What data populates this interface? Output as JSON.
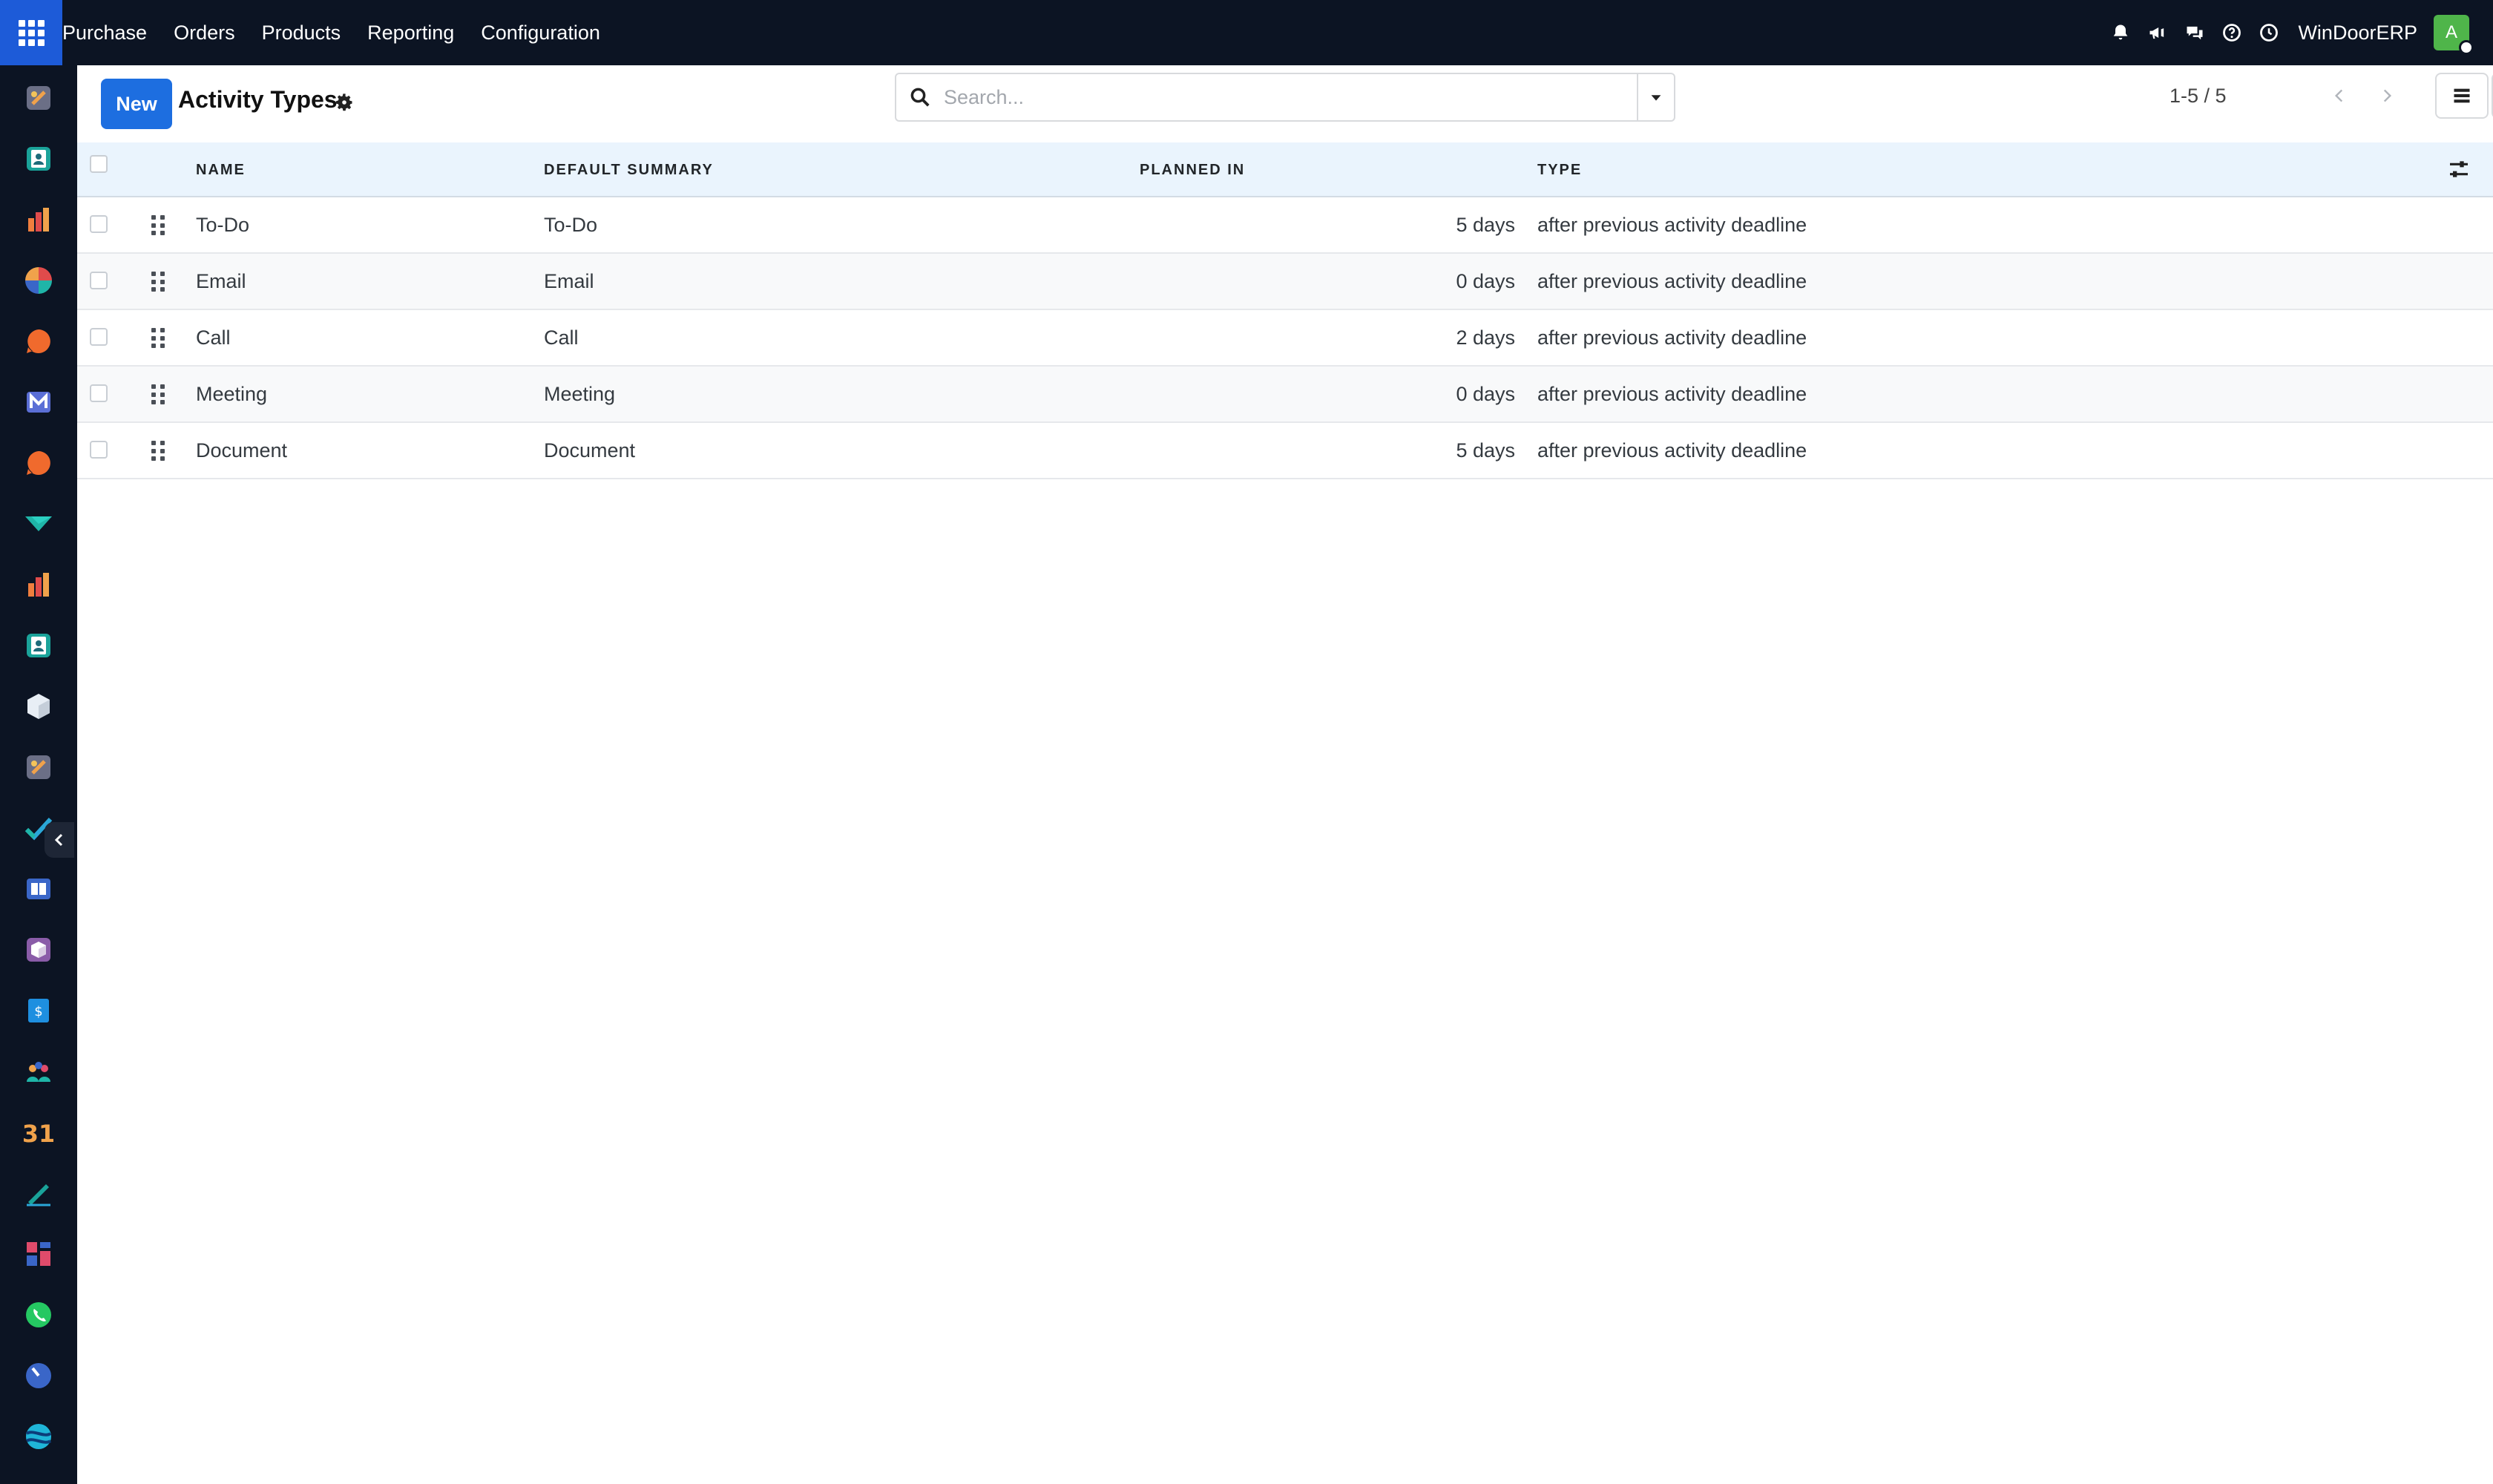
{
  "topbar": {
    "menu": [
      "Purchase",
      "Orders",
      "Products",
      "Reporting",
      "Configuration"
    ],
    "company": "WinDoorERP",
    "avatar_initial": "A",
    "icons": [
      "bell-icon",
      "megaphone-icon",
      "chat-icon",
      "help-icon",
      "clock-icon"
    ]
  },
  "sidebar": {
    "apps": [
      {
        "icon": "discuss-app-icon",
        "color": "#f0a24b"
      },
      {
        "icon": "contacts-app-icon",
        "color": "#1aa39a"
      },
      {
        "icon": "sales-app-icon",
        "color": "#f07e3e"
      },
      {
        "icon": "crm-app-icon",
        "color": "#e04b4b"
      },
      {
        "icon": "chat-app-icon",
        "color": "#f06a2d"
      },
      {
        "icon": "email-marketing-app-icon",
        "color": "#5b6fd6"
      },
      {
        "icon": "livechat-app-icon",
        "color": "#f06a2d"
      },
      {
        "icon": "surveys-app-icon",
        "color": "#1fb5a8"
      },
      {
        "icon": "reporting-app-icon",
        "color": "#f07e3e"
      },
      {
        "icon": "employees-app-icon",
        "color": "#1aa39a"
      },
      {
        "icon": "inventory-app-icon",
        "color": "#e8eef5"
      },
      {
        "icon": "settings-app-icon",
        "color": "#f0a24b"
      },
      {
        "icon": "project-app-icon",
        "color": "#2aa7d8"
      },
      {
        "icon": "knowledge-app-icon",
        "color": "#3a66c8"
      },
      {
        "icon": "purchase-app-icon",
        "color": "#8a5ca8"
      },
      {
        "icon": "invoicing-app-icon",
        "color": "#1e8fe0"
      },
      {
        "icon": "team-app-icon",
        "color": "#f0a24b"
      },
      {
        "icon": "calendar-app-icon",
        "color": "#f0a24b"
      },
      {
        "icon": "sign-app-icon",
        "color": "#1aa39a"
      },
      {
        "icon": "dashboards-app-icon",
        "color": "#e04b6b"
      },
      {
        "icon": "whatsapp-app-icon",
        "color": "#25c862"
      },
      {
        "icon": "timesheet-app-icon",
        "color": "#3a66c8"
      },
      {
        "icon": "website-app-icon",
        "color": "#1fb5d8"
      }
    ]
  },
  "control": {
    "new_label": "New",
    "title": "Activity Types",
    "search_placeholder": "Search...",
    "pager": "1-5 / 5"
  },
  "table": {
    "columns": [
      "NAME",
      "DEFAULT SUMMARY",
      "PLANNED IN",
      "TYPE"
    ],
    "rows": [
      {
        "name": "To-Do",
        "summary": "To-Do",
        "planned": "5 days",
        "type": "after previous activity deadline"
      },
      {
        "name": "Email",
        "summary": "Email",
        "planned": "0 days",
        "type": "after previous activity deadline"
      },
      {
        "name": "Call",
        "summary": "Call",
        "planned": "2 days",
        "type": "after previous activity deadline"
      },
      {
        "name": "Meeting",
        "summary": "Meeting",
        "planned": "0 days",
        "type": "after previous activity deadline"
      },
      {
        "name": "Document",
        "summary": "Document",
        "planned": "5 days",
        "type": "after previous activity deadline"
      }
    ]
  }
}
